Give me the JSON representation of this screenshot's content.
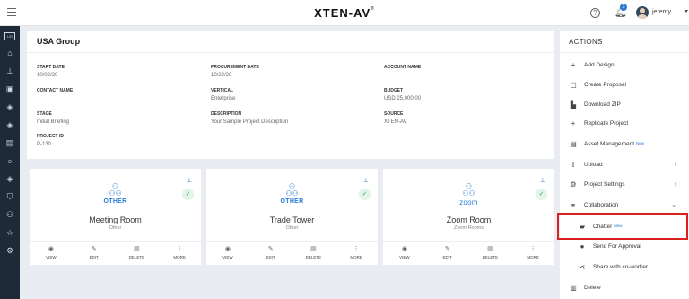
{
  "app": {
    "brand": "XTEN-AV",
    "brand_mark": "®",
    "menu_icon": "hamburger-icon",
    "help_icon": "question-circle-icon",
    "notification_count": "3",
    "user_name": "jeremy"
  },
  "rail": {
    "logo_text": "UG",
    "icons": [
      "home-icon",
      "sitemap-icon",
      "briefcase-icon",
      "layers-icon",
      "layers-icon",
      "file-icon",
      "search-icon",
      "layers-icon",
      "shield-icon",
      "users-icon",
      "star-icon",
      "settings-icon"
    ]
  },
  "project": {
    "title": "USA Group",
    "fields": {
      "start_date": {
        "label": "START DATE",
        "value": "10/02/20"
      },
      "procurement_date": {
        "label": "PROCUREMENT DATE",
        "value": "10/22/20"
      },
      "account_name": {
        "label": "ACCOUNT NAME",
        "value": ""
      },
      "contact_name": {
        "label": "CONTACT NAME",
        "value": ""
      },
      "vertical": {
        "label": "VERTICAL",
        "value": "Enterprise"
      },
      "budget": {
        "label": "BUDGET",
        "value": "USD 25,000.00"
      },
      "stage": {
        "label": "STAGE",
        "value": "Initial Briefing"
      },
      "description": {
        "label": "DESCRIPTION",
        "value": "Your Sample Project Description"
      },
      "source": {
        "label": "SOURCE",
        "value": "XTEN-AV"
      },
      "project_id": {
        "label": "PROJECT ID",
        "value": "P-130"
      }
    }
  },
  "cards": [
    {
      "type_tag": "OTHER",
      "name": "Meeting Room",
      "subtitle": "Other"
    },
    {
      "type_tag": "OTHER",
      "name": "Trade Tower",
      "subtitle": "Other"
    },
    {
      "type_tag": "zoom",
      "name": "Zoom Room",
      "subtitle": "Zoom Rooms"
    }
  ],
  "card_actions": {
    "view": "VIEW",
    "edit": "EDIT",
    "delete": "DELETE",
    "more": "MORE"
  },
  "actions_panel": {
    "title": "ACTIONS",
    "items": [
      {
        "label": "Add Design",
        "icon": "plus-icon"
      },
      {
        "label": "Create Proposal",
        "icon": "document-icon"
      },
      {
        "label": "Download ZIP",
        "icon": "file-zip-icon"
      },
      {
        "label": "Replicate Project",
        "icon": "plus-icon"
      },
      {
        "label": "Asset Management",
        "badge": "New",
        "icon": "list-icon"
      },
      {
        "label": "Upload",
        "icon": "upload-icon"
      },
      {
        "label": "Project Settings",
        "icon": "gear-icon"
      },
      {
        "label": "Collaboration",
        "icon": "handshake-icon"
      },
      {
        "label": "Chatter",
        "badge": "New",
        "icon": "chat-icon"
      },
      {
        "label": "Send For Approval",
        "icon": "send-icon"
      },
      {
        "label": "Share with co-worker",
        "icon": "share-icon"
      },
      {
        "label": "Delete",
        "icon": "trash-icon"
      }
    ]
  },
  "colors": {
    "accent": "#2a7bd6",
    "highlight": "#d9221f",
    "rail": "#1e2a37",
    "ok": "#3aa64d"
  }
}
